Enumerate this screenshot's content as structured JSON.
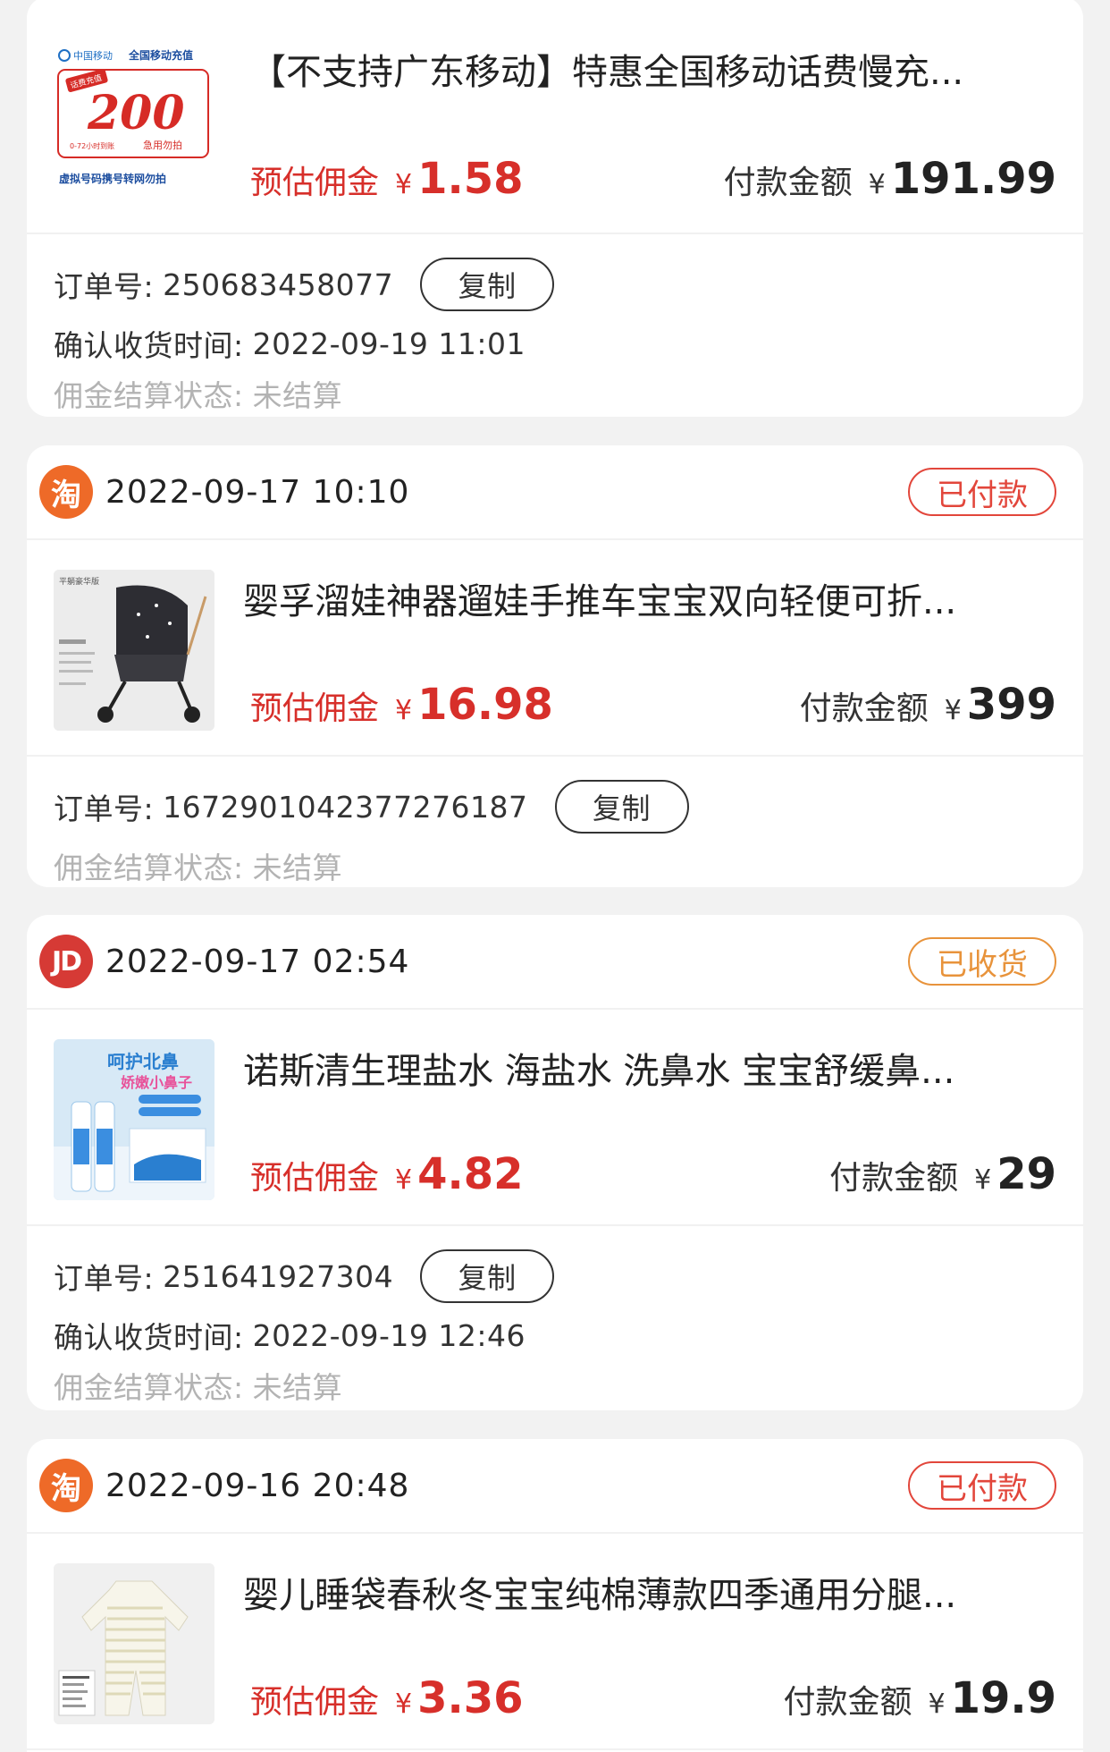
{
  "orders": [
    {
      "product_title": "【不支持广东移动】特惠全国移动话费慢充...",
      "commission_label": "预估佣金",
      "currency": "¥",
      "commission": "1.58",
      "payment_label": "付款金额",
      "payment": "191.99",
      "order_no_label": "订单号:",
      "order_no": "250683458077",
      "copy_label": "复制",
      "confirm_label": "确认收货时间:",
      "confirm_time": "2022-09-19 11:01",
      "settle_label": "佣金结算状态:",
      "settle_status": "未结算",
      "thumb_text": {
        "brand": "中国移动",
        "service": "全国移动充值",
        "amount": "200",
        "tag": "话费充值",
        "note": "0-72小时到账",
        "urgent": "急用勿拍",
        "footer": "虚拟号码携号转网勿拍"
      }
    },
    {
      "platform": "淘",
      "datetime": "2022-09-17 10:10",
      "status": "已付款",
      "product_title": "婴孚溜娃神器遛娃手推车宝宝双向轻便可折...",
      "commission_label": "预估佣金",
      "currency": "¥",
      "commission": "16.98",
      "payment_label": "付款金额",
      "payment": "399",
      "order_no_label": "订单号:",
      "order_no": "1672901042377276187",
      "copy_label": "复制",
      "settle_label": "佣金结算状态:",
      "settle_status": "未结算",
      "thumb_text": {
        "tag": "平躺豪华版"
      }
    },
    {
      "platform": "JD",
      "datetime": "2022-09-17 02:54",
      "status": "已收货",
      "product_title": "诺斯清生理盐水 海盐水 洗鼻水 宝宝舒缓鼻...",
      "commission_label": "预估佣金",
      "currency": "¥",
      "commission": "4.82",
      "payment_label": "付款金额",
      "payment": "29",
      "order_no_label": "订单号:",
      "order_no": "251641927304",
      "copy_label": "复制",
      "confirm_label": "确认收货时间:",
      "confirm_time": "2022-09-19 12:46",
      "settle_label": "佣金结算状态:",
      "settle_status": "未结算",
      "thumb_text": {
        "line1": "呵护北鼻",
        "line2": "娇嫩小鼻子"
      }
    },
    {
      "platform": "淘",
      "datetime": "2022-09-16 20:48",
      "status": "已付款",
      "product_title": "婴儿睡袋春秋冬宝宝纯棉薄款四季通用分腿...",
      "commission_label": "预估佣金",
      "currency": "¥",
      "commission": "3.36",
      "payment_label": "付款金额",
      "payment": "19.9"
    }
  ],
  "colors": {
    "commission_red": "#d72f2a",
    "status_paid": "#e2463b",
    "status_received": "#e8933b",
    "taobao_badge": "#ee6a28",
    "jd_badge": "#d63a35"
  }
}
